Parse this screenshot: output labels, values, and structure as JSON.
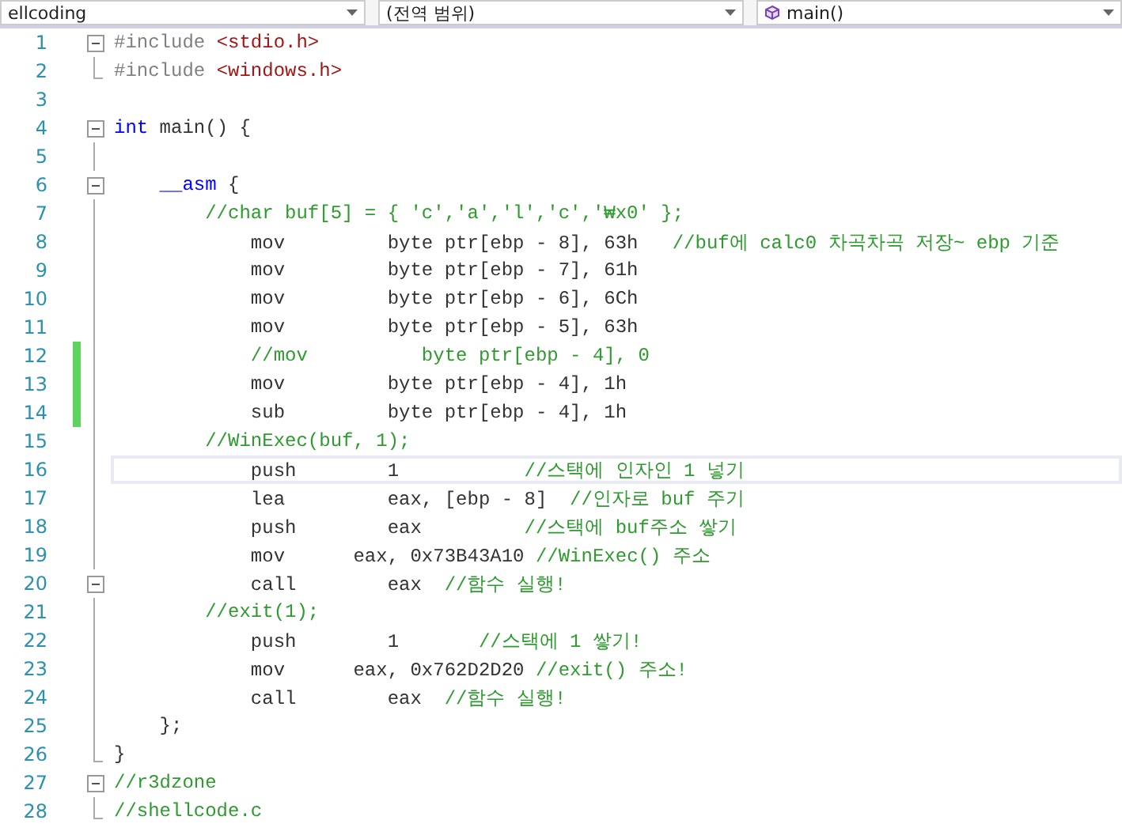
{
  "navigation_bar": {
    "dropdowns": [
      {
        "label": "ellcoding",
        "kind": "plain"
      },
      {
        "label": "(전역 범위)",
        "kind": "plain"
      },
      {
        "label": "main()",
        "kind": "function"
      }
    ]
  },
  "editor": {
    "lines": [
      {
        "number": "1",
        "kind": "fold-open",
        "changed": false,
        "current": false,
        "tokens": [
          {
            "kind": "preprocessor",
            "text": "#include "
          },
          {
            "kind": "string",
            "text": "<stdio.h>"
          }
        ]
      },
      {
        "number": "2",
        "kind": "fold-end",
        "changed": false,
        "current": false,
        "tokens": [
          {
            "kind": "preprocessor",
            "text": "#include "
          },
          {
            "kind": "string",
            "text": "<windows.h>"
          }
        ]
      },
      {
        "number": "3",
        "kind": "plain",
        "changed": false,
        "current": false
      },
      {
        "number": "4",
        "kind": "fold-open",
        "changed": false,
        "current": false,
        "tokens": [
          {
            "kind": "keyword",
            "text": "int"
          },
          {
            "kind": "plain",
            "text": " main() {"
          }
        ]
      },
      {
        "number": "5",
        "kind": "fold-line",
        "changed": false,
        "current": false
      },
      {
        "number": "6",
        "kind": "fold-open",
        "changed": false,
        "current": false,
        "tokens": [
          {
            "kind": "keyword",
            "text": "    __asm"
          },
          {
            "kind": "plain",
            "text": " {"
          }
        ]
      },
      {
        "number": "7",
        "kind": "fold-line",
        "changed": false,
        "current": false,
        "tokens": [
          {
            "kind": "comment",
            "text": "        //char buf[5] = { 'c','a','l','c','₩x0' };"
          }
        ]
      },
      {
        "number": "8",
        "kind": "fold-line",
        "changed": false,
        "current": false,
        "tokens": [
          {
            "kind": "plain",
            "text": "            mov         byte ptr[ebp - 8], 63h   "
          },
          {
            "kind": "comment",
            "text": "//buf에 calc0 차곡차곡 저장~ ebp 기준"
          }
        ]
      },
      {
        "number": "9",
        "kind": "fold-line",
        "changed": false,
        "current": false,
        "tokens": [
          {
            "kind": "plain",
            "text": "            mov         byte ptr[ebp - 7], 61h"
          }
        ]
      },
      {
        "number": "10",
        "kind": "fold-line",
        "changed": false,
        "current": false,
        "tokens": [
          {
            "kind": "plain",
            "text": "            mov         byte ptr[ebp - 6], 6Ch"
          }
        ]
      },
      {
        "number": "11",
        "kind": "fold-line",
        "changed": false,
        "current": false,
        "tokens": [
          {
            "kind": "plain",
            "text": "            mov         byte ptr[ebp - 5], 63h"
          }
        ]
      },
      {
        "number": "12",
        "kind": "fold-line",
        "changed": true,
        "current": false,
        "tokens": [
          {
            "kind": "comment",
            "text": "            //mov          byte ptr[ebp - 4], 0"
          }
        ]
      },
      {
        "number": "13",
        "kind": "fold-line",
        "changed": true,
        "current": false,
        "tokens": [
          {
            "kind": "plain",
            "text": "            mov         byte ptr[ebp - 4], 1h"
          }
        ]
      },
      {
        "number": "14",
        "kind": "fold-line",
        "changed": true,
        "current": false,
        "tokens": [
          {
            "kind": "plain",
            "text": "            sub         byte ptr[ebp - 4], 1h"
          }
        ]
      },
      {
        "number": "15",
        "kind": "fold-line",
        "changed": false,
        "current": false,
        "tokens": [
          {
            "kind": "comment",
            "text": "        //WinExec(buf, 1);"
          }
        ]
      },
      {
        "number": "16",
        "kind": "fold-line",
        "changed": false,
        "current": true,
        "tokens": [
          {
            "kind": "plain",
            "text": "            push        1           "
          },
          {
            "kind": "comment",
            "text": "//스택에 인자인 1 넣기"
          }
        ]
      },
      {
        "number": "17",
        "kind": "fold-line",
        "changed": false,
        "current": false,
        "tokens": [
          {
            "kind": "plain",
            "text": "            lea         eax, [ebp - 8]  "
          },
          {
            "kind": "comment",
            "text": "//인자로 buf 주기"
          }
        ]
      },
      {
        "number": "18",
        "kind": "fold-line",
        "changed": false,
        "current": false,
        "tokens": [
          {
            "kind": "plain",
            "text": "            push        eax         "
          },
          {
            "kind": "comment",
            "text": "//스택에 buf주소 쌓기"
          }
        ]
      },
      {
        "number": "19",
        "kind": "fold-line",
        "changed": false,
        "current": false,
        "tokens": [
          {
            "kind": "plain",
            "text": "            mov      eax, 0x73B43A10 "
          },
          {
            "kind": "comment",
            "text": "//WinExec() 주소"
          }
        ]
      },
      {
        "number": "20",
        "kind": "fold-open",
        "changed": false,
        "current": false,
        "tokens": [
          {
            "kind": "plain",
            "text": "            call        eax  "
          },
          {
            "kind": "comment",
            "text": "//함수 실행!"
          }
        ]
      },
      {
        "number": "21",
        "kind": "fold-line",
        "changed": false,
        "current": false,
        "tokens": [
          {
            "kind": "comment",
            "text": "        //exit(1);"
          }
        ]
      },
      {
        "number": "22",
        "kind": "fold-line",
        "changed": false,
        "current": false,
        "tokens": [
          {
            "kind": "plain",
            "text": "            push        1       "
          },
          {
            "kind": "comment",
            "text": "//스택에 1 쌓기!"
          }
        ]
      },
      {
        "number": "23",
        "kind": "fold-line",
        "changed": false,
        "current": false,
        "tokens": [
          {
            "kind": "plain",
            "text": "            mov      eax, 0x762D2D20 "
          },
          {
            "kind": "comment",
            "text": "//exit() 주소!"
          }
        ]
      },
      {
        "number": "24",
        "kind": "fold-line",
        "changed": false,
        "current": false,
        "tokens": [
          {
            "kind": "plain",
            "text": "            call        eax  "
          },
          {
            "kind": "comment",
            "text": "//함수 실행!"
          }
        ]
      },
      {
        "number": "25",
        "kind": "fold-line",
        "changed": false,
        "current": false,
        "tokens": [
          {
            "kind": "plain",
            "text": "    };"
          }
        ]
      },
      {
        "number": "26",
        "kind": "fold-end",
        "changed": false,
        "current": false,
        "tokens": [
          {
            "kind": "plain",
            "text": "}"
          }
        ]
      },
      {
        "number": "27",
        "kind": "fold-open",
        "changed": false,
        "current": false,
        "tokens": [
          {
            "kind": "comment",
            "text": "//r3dzone"
          }
        ]
      },
      {
        "number": "28",
        "kind": "fold-end",
        "changed": false,
        "current": false,
        "tokens": [
          {
            "kind": "comment",
            "text": "//shellcode.c"
          }
        ]
      }
    ]
  }
}
